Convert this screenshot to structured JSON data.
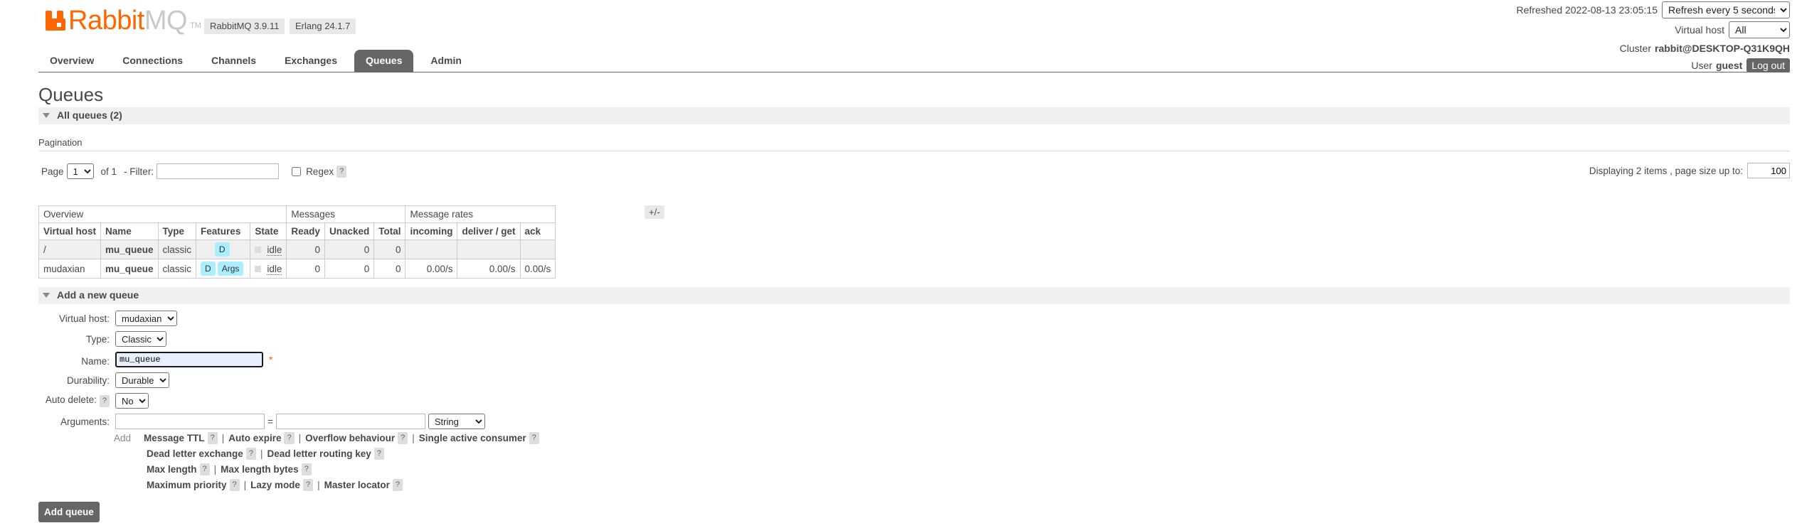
{
  "app": {
    "logo_rabbit": "Rabbit",
    "logo_mq": "MQ",
    "logo_tm": "TM",
    "version": "RabbitMQ 3.9.11",
    "erlang": "Erlang 24.1.7",
    "brand_color": "#ff6600"
  },
  "status": {
    "refreshed": "Refreshed 2022-08-13 23:05:15",
    "refresh_option": "Refresh every 5 seconds",
    "vhost_label": "Virtual host",
    "vhost_value": "All",
    "cluster_label": "Cluster",
    "cluster_value": "rabbit@DESKTOP-Q31K9QH",
    "user_label": "User",
    "user_value": "guest",
    "logout": "Log out"
  },
  "nav": {
    "tabs": [
      "Overview",
      "Connections",
      "Channels",
      "Exchanges",
      "Queues",
      "Admin"
    ],
    "active": "Queues"
  },
  "page": {
    "title": "Queues",
    "all_queues": "All queues (2)",
    "pagination": "Pagination",
    "page_label": "Page",
    "page_value": "1",
    "of_label": "of 1",
    "filter_label": "- Filter:",
    "regex_label": "Regex",
    "help": "?",
    "display_info": "Displaying 2 items , page size up to:",
    "page_size": "100",
    "plus_minus": "+/-"
  },
  "table": {
    "groups": [
      "Overview",
      "Messages",
      "Message rates"
    ],
    "columns": [
      "Virtual host",
      "Name",
      "Type",
      "Features",
      "State",
      "Ready",
      "Unacked",
      "Total",
      "incoming",
      "deliver / get",
      "ack"
    ],
    "rows": [
      {
        "vhost": "/",
        "name": "mu_queue",
        "type": "classic",
        "feat1": "D",
        "feat2": "",
        "state": "idle",
        "ready": "0",
        "unacked": "0",
        "total": "0",
        "incoming": "",
        "deliver": "",
        "ack": ""
      },
      {
        "vhost": "mudaxian",
        "name": "mu_queue",
        "type": "classic",
        "feat1": "D",
        "feat2": "Args",
        "state": "idle",
        "ready": "0",
        "unacked": "0",
        "total": "0",
        "incoming": "0.00/s",
        "deliver": "0.00/s",
        "ack": "0.00/s"
      }
    ]
  },
  "add_queue": {
    "section_title": "Add a new queue",
    "virtual_host_label": "Virtual host:",
    "virtual_host_value": "mudaxian",
    "type_label": "Type:",
    "type_value": "Classic",
    "name_label": "Name:",
    "name_value": "mu_queue",
    "required": "*",
    "durability_label": "Durability:",
    "durability_value": "Durable",
    "auto_delete_label": "Auto delete:",
    "auto_delete_value": "No",
    "arguments_label": "Arguments:",
    "equals": "=",
    "arg_type": "String",
    "add_label": "Add",
    "arg_links": [
      [
        "Message TTL",
        "Auto expire",
        "Overflow behaviour",
        "Single active consumer"
      ],
      [
        "Dead letter exchange",
        "Dead letter routing key"
      ],
      [
        "Max length",
        "Max length bytes"
      ],
      [
        "Maximum priority",
        "Lazy mode",
        "Master locator"
      ]
    ],
    "submit": "Add queue"
  }
}
